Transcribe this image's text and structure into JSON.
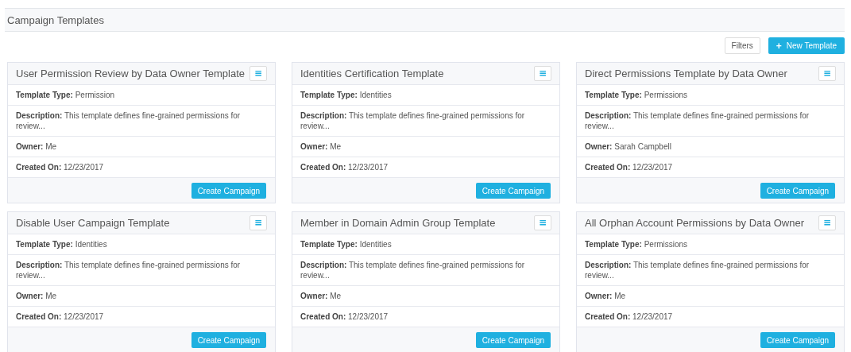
{
  "page_title": "Campaign Templates",
  "toolbar": {
    "filters_button": "Filters",
    "new_button": {
      "icon": "+",
      "label": "New Template"
    }
  },
  "cards": [
    {
      "title": "User Permission Review by Data Owner Template",
      "menu_icon": "≡",
      "fields": [
        "**Template Type:** Permission",
        "**Description:** This template defines fine-grained permissions for review...",
        "**Owner:** Me",
        "**Created On:** 12/23/2017"
      ],
      "action": "Create Campaign"
    },
    {
      "title": "Identities Certification Template",
      "menu_icon": "≡",
      "fields": [
        "**Template Type:** Identities",
        "**Description:** This template defines fine-grained permissions for review...",
        "**Owner:** Me",
        "**Created On:** 12/23/2017"
      ],
      "action": "Create Campaign"
    },
    {
      "title": "Direct Permissions Template by Data Owner",
      "menu_icon": "≡",
      "fields": [
        "**Template Type:** Permissions",
        "**Description:** This template defines fine-grained permissions for review...",
        "**Owner:** Sarah Campbell",
        "**Created On:** 12/23/2017"
      ],
      "action": "Create Campaign"
    },
    {
      "title": "Disable User Campaign Template",
      "menu_icon": "≡",
      "fields": [
        "**Template Type:** Identities",
        "**Description:** This template defines fine-grained permissions for review...",
        "**Owner:** Me",
        "**Created On:** 12/23/2017"
      ],
      "action": "Create Campaign"
    },
    {
      "title": "Member in Domain Admin Group Template",
      "menu_icon": "≡",
      "fields": [
        "**Template Type:** Identities",
        "**Description:** This template defines fine-grained permissions for review...",
        "**Owner:** Me",
        "**Created On:** 12/23/2017"
      ],
      "action": "Create Campaign"
    },
    {
      "title": "All Orphan Account Permissions by Data Owner",
      "menu_icon": "≡",
      "fields": [
        "**Template Type:** Permissions",
        "**Description:** This template defines fine-grained permissions for review...",
        "**Owner:** Me",
        "**Created On:** 12/23/2017"
      ],
      "action": "Create Campaign"
    }
  ]
}
